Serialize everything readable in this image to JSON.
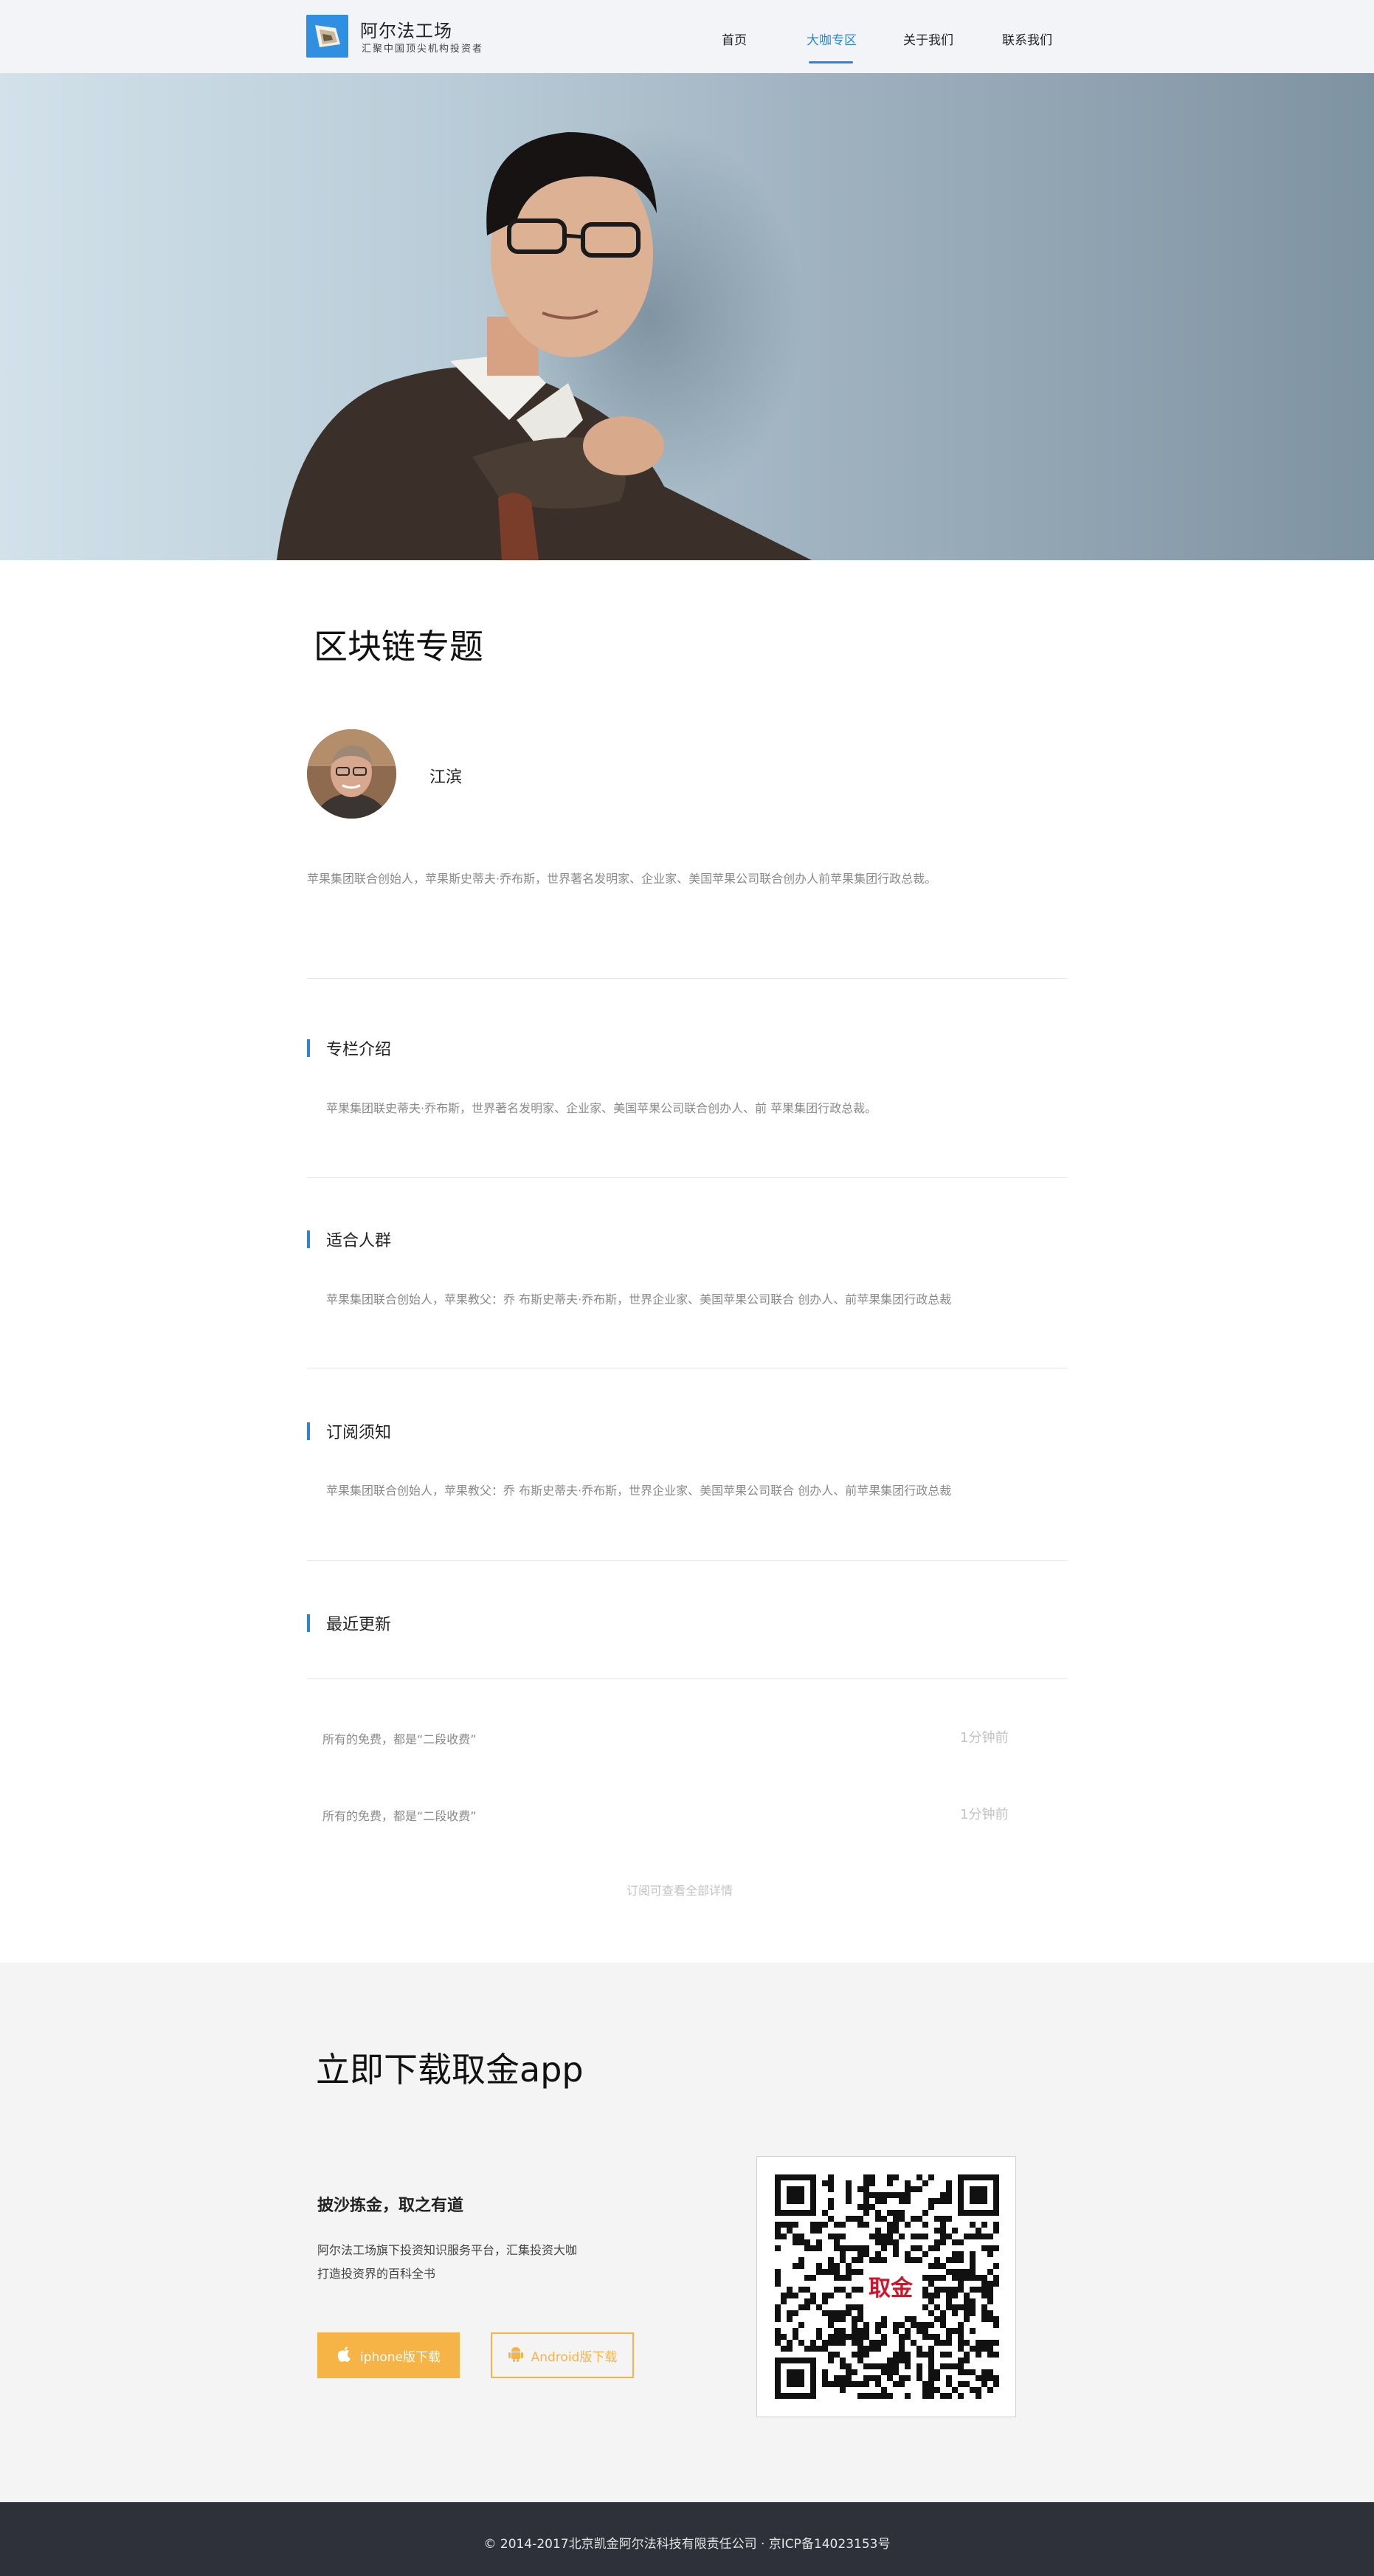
{
  "header": {
    "brand_name": "阿尔法工场",
    "brand_sub": "汇聚中国顶尖机构投资者",
    "nav": [
      "首页",
      "大咖专区",
      "关于我们",
      "联系我们"
    ],
    "active_nav": "大咖专区"
  },
  "main": {
    "title": "区块链专题",
    "author_name": "江滨",
    "author_desc": "苹果集团联合创始人，苹果斯史蒂夫·乔布斯，世界著名发明家、企业家、美国苹果公司联合创办人前苹果集团行政总裁。",
    "sections": [
      {
        "title": "专栏介绍",
        "text": "苹果集团联史蒂夫·乔布斯，世界著名发明家、企业家、美国苹果公司联合创办人、前 苹果集团行政总裁。"
      },
      {
        "title": "适合人群",
        "text": "苹果集团联合创始人，苹果教父：乔 布斯史蒂夫·乔布斯，世界企业家、美国苹果公司联合 创办人、前苹果集团行政总裁"
      },
      {
        "title": "订阅须知",
        "text": "苹果集团联合创始人，苹果教父：乔 布斯史蒂夫·乔布斯，世界企业家、美国苹果公司联合 创办人、前苹果集团行政总裁"
      }
    ],
    "updates_title": "最近更新",
    "updates": [
      {
        "title": "所有的免费，都是“二段收费”",
        "time": "1分钟前"
      },
      {
        "title": "所有的免费，都是“二段收费”",
        "time": "1分钟前"
      }
    ],
    "more_link": "订阅可查看全部详情"
  },
  "download": {
    "title": "立即下载取金app",
    "slogan": "披沙拣金，取之有道",
    "lines": [
      "阿尔法工场旗下投资知识服务平台，汇集投资大咖",
      "打造投资界的百科全书"
    ],
    "iphone_btn": "iphone版下载",
    "android_btn": "Android版下载",
    "qr_badge": "取金"
  },
  "footer": {
    "text": "© 2014-2017北京凯金阿尔法科技有限责任公司 · 京ICP备14023153号"
  },
  "colors": {
    "accent": "#2a86d8",
    "download_orange": "#f6b346",
    "footer_bg": "#2e303a",
    "qr_badge_red": "#d4132a"
  }
}
